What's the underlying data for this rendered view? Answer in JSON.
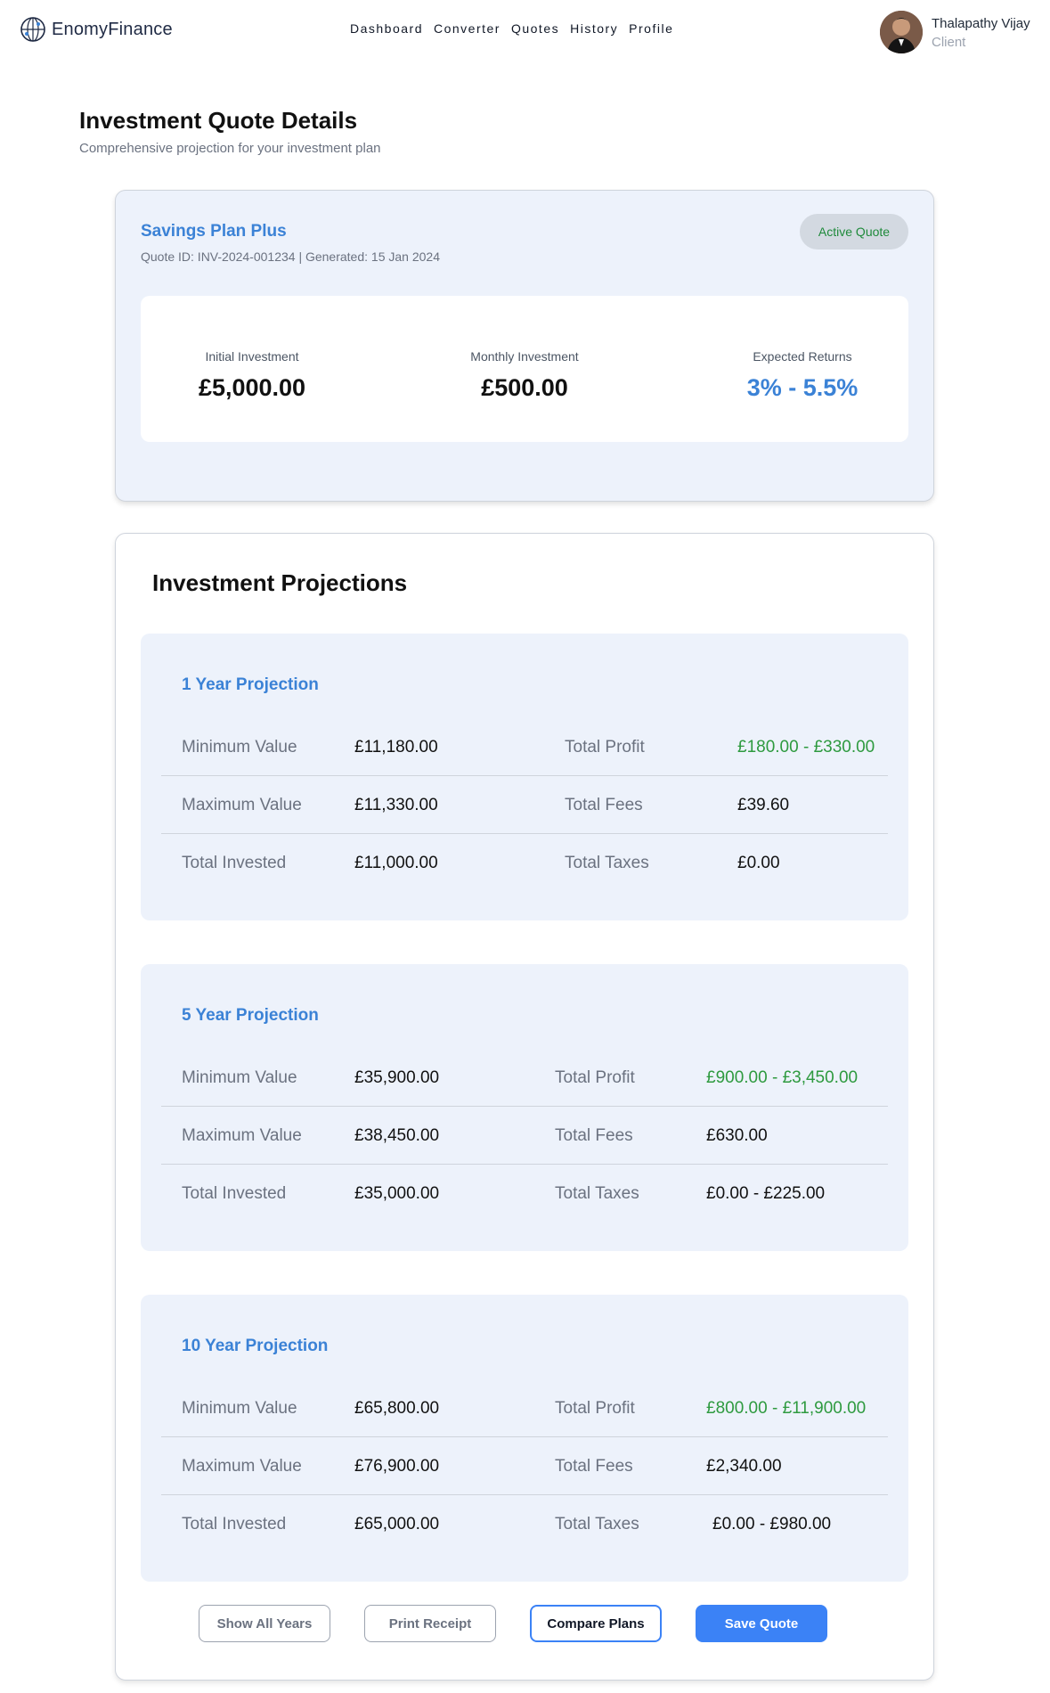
{
  "header": {
    "logo_text": "EnomyFinance",
    "nav": [
      "Dashboard",
      "Converter",
      "Quotes",
      "History",
      "Profile"
    ],
    "user": {
      "name": "Thalapathy Vijay",
      "role": "Client"
    }
  },
  "page": {
    "title": "Investment Quote Details",
    "subtitle": "Comprehensive projection for your investment plan"
  },
  "quote": {
    "plan_name": "Savings Plan Plus",
    "meta": "Quote ID: INV-2024-001234 | Generated: 15 Jan 2024",
    "badge": "Active Quote",
    "summary": {
      "initial_label": "Initial Investment",
      "initial_value": "£5,000.00",
      "monthly_label": "Monthly Investment",
      "monthly_value": "£500.00",
      "returns_label": "Expected Returns",
      "returns_value": "3% - 5.5%"
    }
  },
  "projections": {
    "title": "Investment Projections",
    "labels": {
      "min": "Minimum Value",
      "max": "Maximum Value",
      "invested": "Total Invested",
      "profit": "Total Profit",
      "fees": "Total Fees",
      "taxes": "Total Taxes"
    },
    "blocks": [
      {
        "title": "1 Year Projection",
        "min": "£11,180.00",
        "max": "£11,330.00",
        "invested": "£11,000.00",
        "profit": "£180.00 - £330.00",
        "fees": "£39.60",
        "taxes": "£0.00"
      },
      {
        "title": "5 Year Projection",
        "min": "£35,900.00",
        "max": "£38,450.00",
        "invested": "£35,000.00",
        "profit": "£900.00 - £3,450.00",
        "fees": "£630.00",
        "taxes": "£0.00 - £225.00"
      },
      {
        "title": "10 Year Projection",
        "min": "£65,800.00",
        "max": "£76,900.00",
        "invested": "£65,000.00",
        "profit": "£800.00 - £11,900.00",
        "fees": "£2,340.00",
        "taxes": "£0.00 - £980.00"
      }
    ]
  },
  "actions": {
    "show_all": "Show All Years",
    "print": "Print Receipt",
    "compare": "Compare Plans",
    "save": "Save Quote"
  },
  "colors": {
    "accent_blue": "#3b82d6",
    "button_blue": "#3b82f6",
    "profit_green": "#2e9a3f",
    "card_bg": "#edf2fb"
  }
}
